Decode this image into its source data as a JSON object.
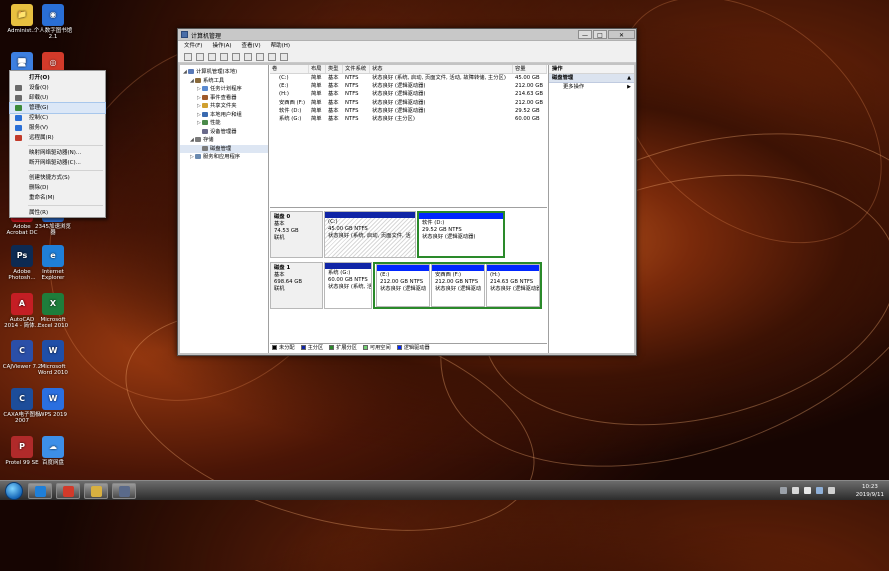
{
  "desktop_icons": [
    {
      "id": "admin",
      "label": "Administ...",
      "color": "#e8c040",
      "glyph": "📁"
    },
    {
      "id": "library",
      "label": "个人数字图书馆2.1",
      "color": "#2a6fd6",
      "glyph": "◉"
    },
    {
      "id": "computer",
      "label": "",
      "color": "#3d7fe0",
      "glyph": "🖥"
    },
    {
      "id": "chrome",
      "label": "",
      "color": "#d23a2a",
      "glyph": "◎"
    },
    {
      "id": "acrobat",
      "label": "Adobe Acrobat DC",
      "color": "#c0141c",
      "glyph": "A"
    },
    {
      "id": "speedup",
      "label": "2345加速浏览器",
      "color": "#2a6fd6",
      "glyph": "e"
    },
    {
      "id": "photoshop",
      "label": "Adobe Photosh...",
      "color": "#0d2a52",
      "glyph": "Ps"
    },
    {
      "id": "ie",
      "label": "Internet Explorer",
      "color": "#1f7fd8",
      "glyph": "e"
    },
    {
      "id": "autocad",
      "label": "AutoCAD 2014 - 简体...",
      "color": "#c41e24",
      "glyph": "A"
    },
    {
      "id": "excel",
      "label": "Microsoft Excel 2010",
      "color": "#1e7d3b",
      "glyph": "X"
    },
    {
      "id": "cajviewer",
      "label": "CAJViewer 7.2",
      "color": "#2b4fa8",
      "glyph": "C"
    },
    {
      "id": "word",
      "label": "Microsoft Word 2010",
      "color": "#1f4fa8",
      "glyph": "W"
    },
    {
      "id": "caxa",
      "label": "CAXA电子图板2007",
      "color": "#1d4d9a",
      "glyph": "C"
    },
    {
      "id": "wps",
      "label": "WPS 2019",
      "color": "#2a6fe0",
      "glyph": "W"
    },
    {
      "id": "protel",
      "label": "Protel 99 SE",
      "color": "#b02a2a",
      "glyph": "P"
    },
    {
      "id": "baidu",
      "label": "百度网盘",
      "color": "#3d8fe8",
      "glyph": "☁"
    }
  ],
  "context_menu": {
    "items": [
      {
        "label": "打开(O)",
        "bold": true,
        "icon_color": ""
      },
      {
        "label": "设备(Q)",
        "icon_color": "#6a6a6a"
      },
      {
        "label": "卸载(U)",
        "icon_color": "#6a6a6a"
      },
      {
        "label": "管理(G)",
        "icon_color": "#3b8a3b",
        "highlight": true
      },
      {
        "label": "控制(C)",
        "icon_color": "#2a6fd6"
      },
      {
        "label": "服务(V)",
        "icon_color": "#2a6fd6"
      },
      {
        "label": "远程属(R)",
        "icon_color": "#c23a2a"
      },
      {
        "sep": true
      },
      {
        "label": "映射网络驱动器(N)...",
        "icon_color": ""
      },
      {
        "label": "断开网络驱动器(C)...",
        "icon_color": ""
      },
      {
        "sep": true
      },
      {
        "label": "创建快捷方式(S)",
        "icon_color": ""
      },
      {
        "label": "删除(D)",
        "icon_color": ""
      },
      {
        "label": "重命名(M)",
        "icon_color": ""
      },
      {
        "sep": true
      },
      {
        "label": "属性(R)",
        "icon_color": ""
      }
    ]
  },
  "window": {
    "title": "计算机管理",
    "menu": [
      "文件(F)",
      "操作(A)",
      "查看(V)",
      "帮助(H)"
    ],
    "controls": {
      "minimize": "—",
      "maximize": "□",
      "close": "✕"
    },
    "tree": [
      {
        "label": "计算机管理(本地)",
        "indent": 0,
        "color": "#5a7ab8",
        "toggle": "◢"
      },
      {
        "label": "系统工具",
        "indent": 1,
        "color": "#8a6a3a",
        "toggle": "◢"
      },
      {
        "label": "任务计划程序",
        "indent": 2,
        "color": "#5a8ad0",
        "toggle": "▷"
      },
      {
        "label": "事件查看器",
        "indent": 2,
        "color": "#a05a2a",
        "toggle": "▷"
      },
      {
        "label": "共享文件夹",
        "indent": 2,
        "color": "#d0a030",
        "toggle": "▷"
      },
      {
        "label": "本地用户和组",
        "indent": 2,
        "color": "#3a6ab0",
        "toggle": "▷"
      },
      {
        "label": "性能",
        "indent": 2,
        "color": "#4a8a4a",
        "toggle": "▷"
      },
      {
        "label": "设备管理器",
        "indent": 2,
        "color": "#6a6a8a",
        "toggle": ""
      },
      {
        "label": "存储",
        "indent": 1,
        "color": "#7a7a7a",
        "toggle": "◢"
      },
      {
        "label": "磁盘管理",
        "indent": 2,
        "color": "#7a7a7a",
        "toggle": ""
      },
      {
        "label": "服务和应用程序",
        "indent": 1,
        "color": "#6a8ab0",
        "toggle": "▷"
      }
    ],
    "volume_table": {
      "headers": [
        "卷",
        "布局",
        "类型",
        "文件系统",
        "状态",
        "容量"
      ],
      "rows": [
        [
          "(C:)",
          "简单",
          "基本",
          "NTFS",
          "状态良好 (系统, 启动, 页面文件, 活动, 故障转储, 主分区)",
          "45.00 GB"
        ],
        [
          "(E:)",
          "简单",
          "基本",
          "NTFS",
          "状态良好 (逻辑驱动器)",
          "212.00 GB"
        ],
        [
          "(H:)",
          "简单",
          "基本",
          "NTFS",
          "状态良好 (逻辑驱动器)",
          "214.63 GB"
        ],
        [
          "安西西 (F:)",
          "简单",
          "基本",
          "NTFS",
          "状态良好 (逻辑驱动器)",
          "212.00 GB"
        ],
        [
          "软件 (D:)",
          "简单",
          "基本",
          "NTFS",
          "状态良好 (逻辑驱动器)",
          "29.52 GB"
        ],
        [
          "系统 (G:)",
          "简单",
          "基本",
          "NTFS",
          "状态良好 (主分区)",
          "60.00 GB"
        ]
      ]
    },
    "disks": [
      {
        "name": "磁盘 0",
        "type": "基本",
        "size": "74.53 GB",
        "state": "联机",
        "parts": [
          {
            "title": "(C:)",
            "size": "45.00 GB NTFS",
            "status": "状态良好 (系统, 启动, 页面文件, 活",
            "kind": "primary",
            "hatch": true,
            "selected": false
          },
          {
            "title": "软件 (D:)",
            "size": "29.52 GB NTFS",
            "status": "状态良好 (逻辑驱动器)",
            "kind": "logical",
            "hatch": false,
            "selected": true
          }
        ]
      },
      {
        "name": "磁盘 1",
        "type": "基本",
        "size": "698.64 GB",
        "state": "联机",
        "parts": [
          {
            "title": "系统 (G:)",
            "size": "60.00 GB NTFS",
            "status": "状态良好 (系统, 活动, 主",
            "kind": "primary",
            "hatch": false,
            "selected": false
          },
          {
            "title": "(E:)",
            "size": "212.00 GB NTFS",
            "status": "状态良好 (逻辑驱动",
            "kind": "logical",
            "hatch": false,
            "selected": false
          },
          {
            "title": "安西西 (F:)",
            "size": "212.00 GB NTFS",
            "status": "状态良好 (逻辑驱动",
            "kind": "logical",
            "hatch": false,
            "selected": false
          },
          {
            "title": "(H:)",
            "size": "214.63 GB NTFS",
            "status": "状态良好 (逻辑驱动器",
            "kind": "logical",
            "hatch": false,
            "selected": false
          }
        ]
      }
    ],
    "legend": [
      {
        "label": "未分配",
        "color": "#000000"
      },
      {
        "label": "主分区",
        "color": "#1025a6"
      },
      {
        "label": "扩展分区",
        "color": "#2a8a2a"
      },
      {
        "label": "可用空间",
        "color": "#70d070"
      },
      {
        "label": "逻辑驱动器",
        "color": "#0026ff"
      }
    ],
    "actions": {
      "header": "操作",
      "section": "磁盘管理",
      "more": "更多操作"
    }
  },
  "taskbar": {
    "clock_time": "10:23",
    "clock_date": "2019/9/11",
    "apps": [
      {
        "id": "ie",
        "color": "#1f7fd8"
      },
      {
        "id": "chrome",
        "color": "#d23a2a"
      },
      {
        "id": "explorer",
        "color": "#d8b040"
      },
      {
        "id": "compmgmt",
        "color": "#5a6a8a"
      }
    ]
  }
}
